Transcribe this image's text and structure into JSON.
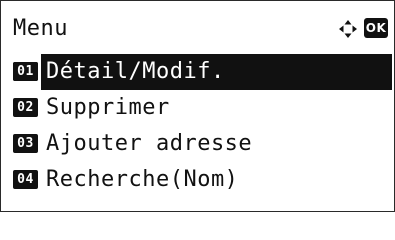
{
  "screen": {
    "title": "Menu",
    "ok_label": "OK"
  },
  "menu": {
    "items": [
      {
        "number": "01",
        "label": "Détail/Modif.",
        "selected": true
      },
      {
        "number": "02",
        "label": "Supprimer",
        "selected": false
      },
      {
        "number": "03",
        "label": "Ajouter adresse",
        "selected": false
      },
      {
        "number": "04",
        "label": "Recherche(Nom)",
        "selected": false
      }
    ]
  },
  "icons": {
    "navigation": "four-way-arrow-icon",
    "ok": "ok-key-icon"
  },
  "colors": {
    "foreground": "#111111",
    "background": "#ffffff"
  }
}
